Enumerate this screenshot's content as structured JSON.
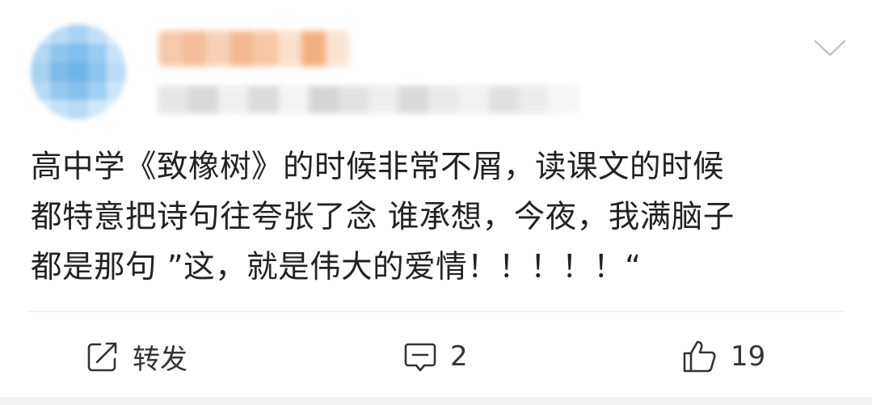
{
  "post": {
    "lines": [
      "高中学《致橡树》的时候非常不屑，读课文的时候",
      "都特意把诗句往夸张了念 谁承想，今夜，我满脑子",
      "都是那句 ”这，就是伟大的爱情！！！！！“"
    ]
  },
  "actions": {
    "repost_label": "转发",
    "comment_count": "2",
    "like_count": "19"
  },
  "icons": {
    "menu": "chevron-down-icon",
    "repost": "share-square-icon",
    "comment": "comment-bubble-icon",
    "like": "thumbs-up-icon"
  },
  "colors": {
    "text": "#222222",
    "icon": "#333333",
    "divider": "#ececec"
  }
}
